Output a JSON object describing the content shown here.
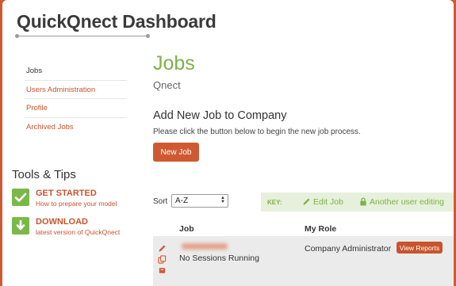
{
  "header": {
    "title": "QuickQnect Dashboard"
  },
  "sidebar": {
    "items": [
      {
        "label": "Jobs"
      },
      {
        "label": "Users Administration"
      },
      {
        "label": "Profile"
      },
      {
        "label": "Archived Jobs"
      }
    ],
    "tools_title": "Tools & Tips",
    "tips": [
      {
        "title": "GET STARTED",
        "subtitle": "How to prepare your model",
        "icon": "check-icon"
      },
      {
        "title": "DOWNLOAD",
        "subtitle": "latest version of QuickQnect",
        "icon": "download-arrow-icon"
      }
    ]
  },
  "main": {
    "title": "Jobs",
    "company": "Qnect",
    "add_title": "Add New Job to Company",
    "add_desc": "Please click the button below to begin the new job process.",
    "new_job_label": "New Job",
    "sort_label": "Sort",
    "sort_value": "A-Z",
    "key": {
      "label": "KEY:",
      "edit": "Edit Job",
      "another": "Another user editing"
    },
    "table": {
      "headers": {
        "job": "Job",
        "role": "My Role"
      },
      "rows": [
        {
          "status": "No Sessions Running",
          "role": "Company Administrator",
          "action": "View Reports"
        }
      ]
    }
  },
  "colors": {
    "accent": "#cf5a32",
    "green": "#7db247",
    "key_bg": "#e6f0dc",
    "row_bg": "#ebebeb"
  }
}
